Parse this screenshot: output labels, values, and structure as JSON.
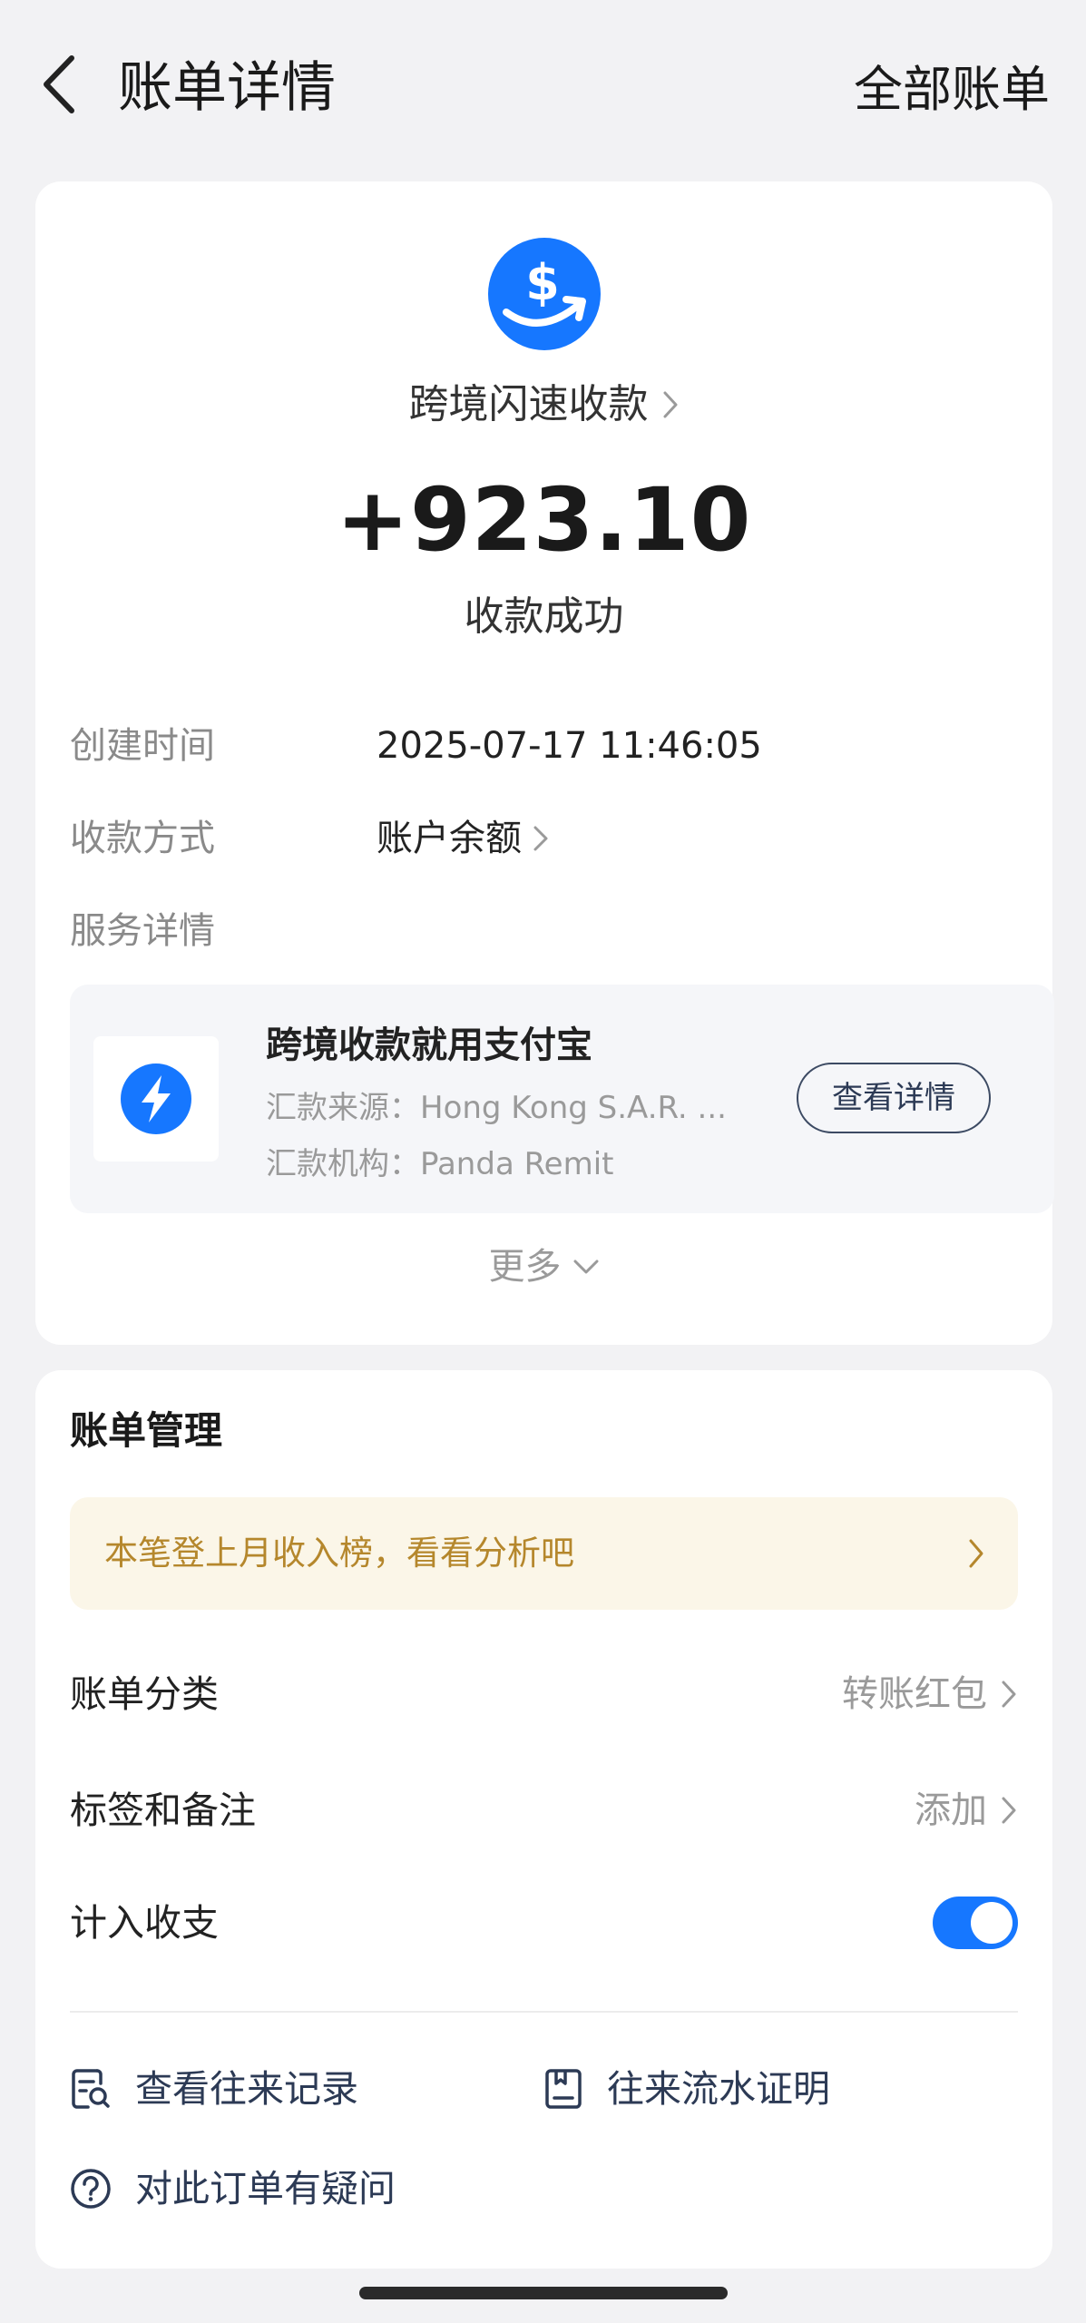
{
  "header": {
    "title": "账单详情",
    "all_bills_label": "全部账单"
  },
  "summary": {
    "business_name": "跨境闪速收款",
    "amount": "+923.10",
    "status": "收款成功"
  },
  "details": {
    "created_label": "创建时间",
    "created_value": "2025-07-17 11:46:05",
    "method_label": "收款方式",
    "method_value": "账户余额",
    "service_label": "服务详情"
  },
  "service": {
    "title": "跨境收款就用支付宝",
    "source": "汇款来源：Hong Kong S.A.R. ...",
    "institution": "汇款机构：Panda Remit",
    "view_detail": "查看详情"
  },
  "more_label": "更多",
  "management": {
    "title": "账单管理",
    "banner_text": "本笔登上月收入榜，看看分析吧",
    "category_label": "账单分类",
    "category_value": "转账红包",
    "tags_label": "标签和备注",
    "tags_value": "添加",
    "count_label": "计入收支",
    "count_enabled": true
  },
  "actions": {
    "history": "查看往来记录",
    "proof": "往来流水证明",
    "question": "对此订单有疑问"
  },
  "colors": {
    "accent": "#1677ff",
    "banner_bg": "#fbf6e8",
    "banner_text": "#b5872c",
    "page_bg": "#f2f2f4"
  },
  "icons": {
    "back": "chevron-left-icon",
    "hero": "dollar-arrow-icon",
    "service": "lightning-icon",
    "history": "record-search-icon",
    "proof": "document-icon",
    "question": "question-circle-icon"
  }
}
